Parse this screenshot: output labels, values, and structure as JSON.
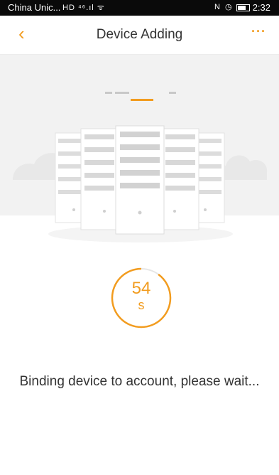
{
  "status_bar": {
    "carrier": "China Unic...",
    "left_icons": "HD ⁴⁶.ıl ᯤ",
    "right_icons": "N ◷",
    "time": "2:32"
  },
  "header": {
    "back_icon": "‹",
    "title": "Device Adding",
    "more_icon": "···"
  },
  "countdown": {
    "value": "54",
    "unit": "s",
    "progress_fraction": 0.9,
    "ring_color": "#f29c1f",
    "track_color": "#e6e6e6"
  },
  "message": "Binding device to account, please wait...",
  "accent_color": "#f29c1f"
}
